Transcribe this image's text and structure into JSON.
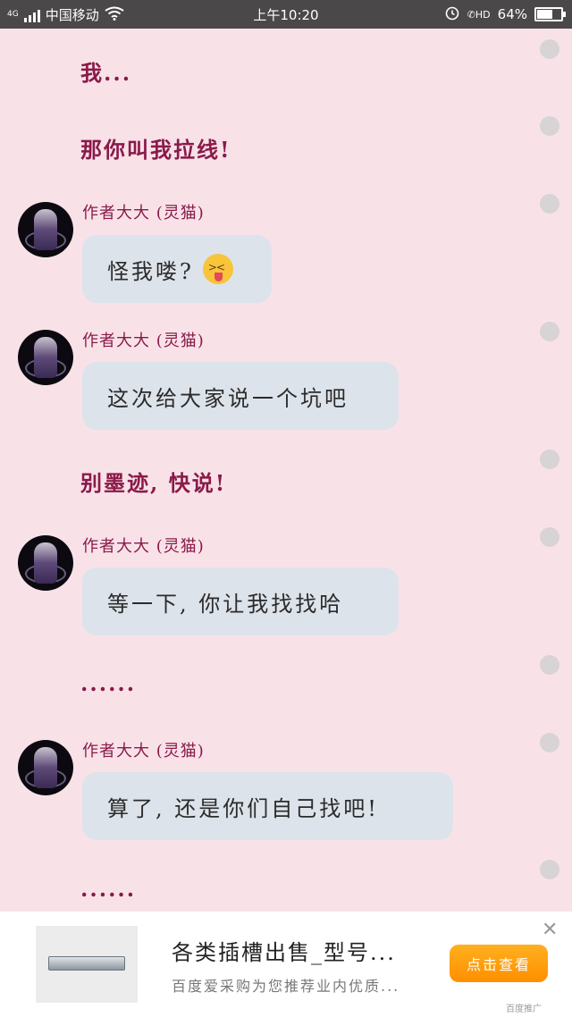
{
  "status_bar": {
    "network_type": "4G",
    "carrier": "中国移动",
    "time": "上午10:20",
    "hd_label": "HD",
    "battery": "64%",
    "battery_level": 0.64
  },
  "messages": [
    {
      "type": "narration",
      "text": "我..."
    },
    {
      "type": "narration",
      "text": "那你叫我拉线!"
    },
    {
      "type": "character",
      "sender": "作者大大 (灵猫)",
      "text": "怪我喽?",
      "emoji": "squinting-tongue-emoji"
    },
    {
      "type": "character",
      "sender": "作者大大 (灵猫)",
      "text": "这次给大家说一个坑吧"
    },
    {
      "type": "narration",
      "text": "别墨迹, 快说!"
    },
    {
      "type": "character",
      "sender": "作者大大 (灵猫)",
      "text": "等一下, 你让我找找哈"
    },
    {
      "type": "narration",
      "text": "......"
    },
    {
      "type": "character",
      "sender": "作者大大 (灵猫)",
      "text": "算了, 还是你们自己找吧!"
    },
    {
      "type": "narration",
      "text": "......"
    }
  ],
  "ad": {
    "title": "各类插槽出售_型号...",
    "subtitle": "百度爱采购为您推荐业内优质...",
    "button": "点击查看",
    "source": "百度推广"
  }
}
